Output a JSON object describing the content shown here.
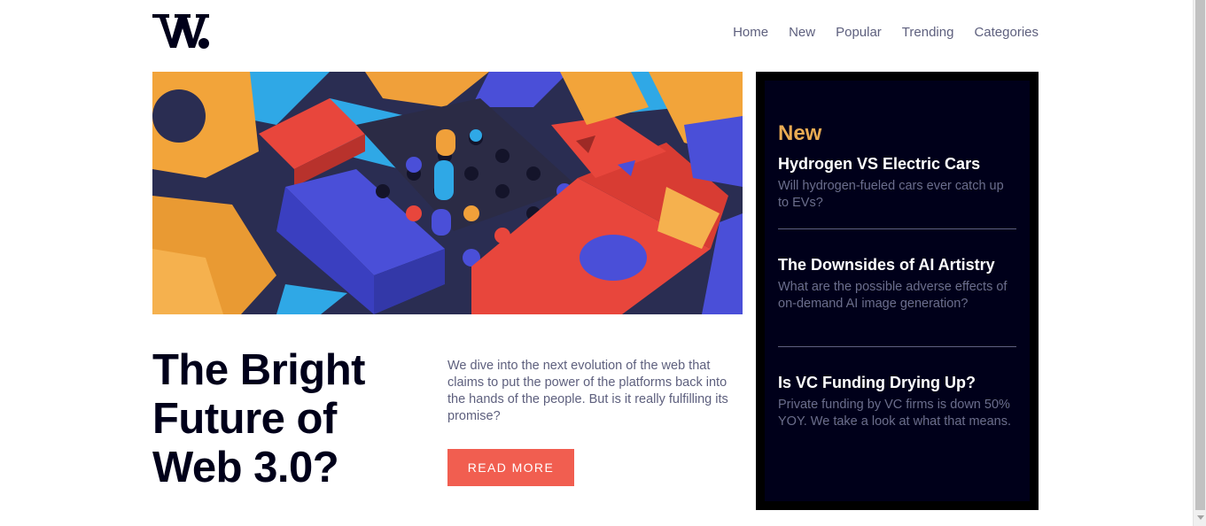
{
  "brand": {
    "logo_text": "W."
  },
  "nav": {
    "items": [
      "Home",
      "New",
      "Popular",
      "Trending",
      "Categories"
    ]
  },
  "hero": {
    "title": "The Bright Future of Web 3.0?",
    "description": "We dive into the next evolution of the web that claims to put the power of the platforms back into the hands of the people. But is it really fulfilling its promise?",
    "cta_label": "READ MORE"
  },
  "sidebar": {
    "title": "New",
    "items": [
      {
        "title": "Hydrogen VS Electric Cars",
        "summary": "Will hydrogen-fueled cars ever catch up to EVs?"
      },
      {
        "title": "The Downsides of AI Artistry",
        "summary": "What are the possible adverse effects of on-demand AI image generation?"
      },
      {
        "title": "Is VC Funding Drying Up?",
        "summary": "Private funding by VC firms is down 50% YOY. We take a look at what that means."
      }
    ]
  },
  "colors": {
    "accent_red": "#f15e50",
    "accent_orange": "#e9ab53",
    "dark_navy": "#00001a",
    "grayish_blue": "#5e607e"
  }
}
